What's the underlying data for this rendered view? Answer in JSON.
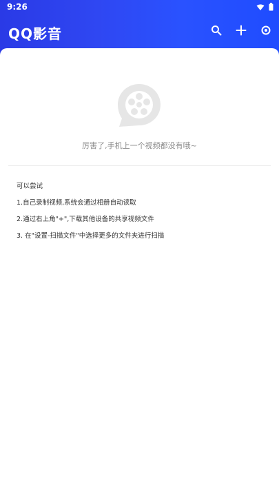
{
  "status_bar": {
    "time": "9:26"
  },
  "header": {
    "title": "QQ影音"
  },
  "empty_state": {
    "message": "厉害了,手机上一个视频都没有哦~"
  },
  "tips": {
    "title": "可以尝试",
    "items": [
      "1.自己录制视频,系统会通过相册自动读取",
      "2.通过右上角\"+\",下载其他设备的共享视频文件",
      "3. 在\"设置-扫描文件\"中选择更多的文件夹进行扫描"
    ]
  },
  "icons": {
    "search": "search-icon",
    "add": "plus-icon",
    "settings": "settings-icon",
    "wifi": "wifi-icon",
    "battery": "battery-icon",
    "empty": "video-reel-icon"
  },
  "colors": {
    "header_start": "#2a3ae6",
    "header_end": "#1f4cff",
    "empty_icon": "#e6e6e6"
  }
}
